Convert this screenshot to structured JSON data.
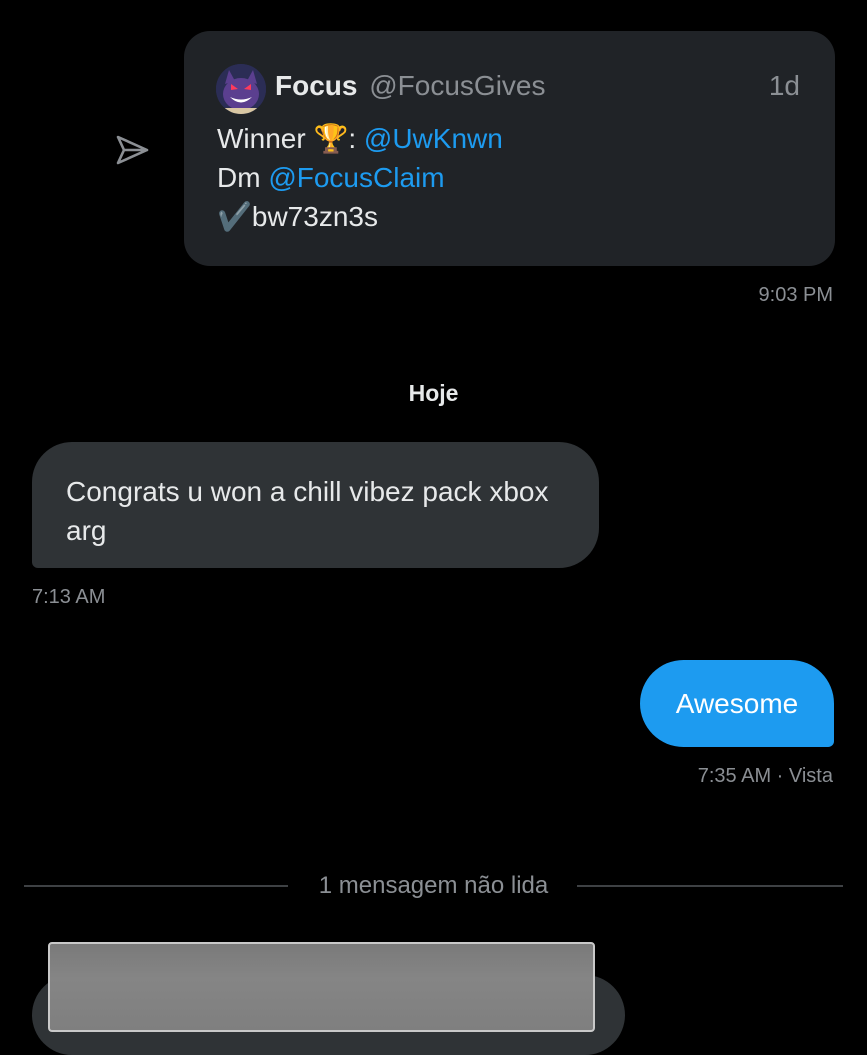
{
  "shared_tweet": {
    "author_name": "Focus",
    "author_handle": "@FocusGives",
    "time_ago": "1d",
    "line1_text": "Winner ",
    "line1_emoji": "🏆",
    "line1_sep": ": ",
    "line1_mention": "@UwKnwn",
    "line2_text": "Dm ",
    "line2_mention": "@FocusClaim",
    "line3_check": "✔️",
    "line3_text": "bw73zn3s",
    "sent_time": "9:03 PM",
    "share_icon": "paper-plane-icon",
    "avatar": "gengar-avatar"
  },
  "day_separator": "Hoje",
  "incoming_message": {
    "text": "Congrats u won a chill vibez pack xbox arg",
    "time": "7:13 AM"
  },
  "outgoing_message": {
    "text": "Awesome",
    "status": "7:35 AM · Vista"
  },
  "unread_divider": "1 mensagem não lida",
  "colors": {
    "background": "#000000",
    "bubble_incoming": "#2f3336",
    "bubble_outgoing": "#1d9bf0",
    "card": "#202327",
    "mention": "#1d9bf0",
    "muted_text": "#8b8f94"
  }
}
